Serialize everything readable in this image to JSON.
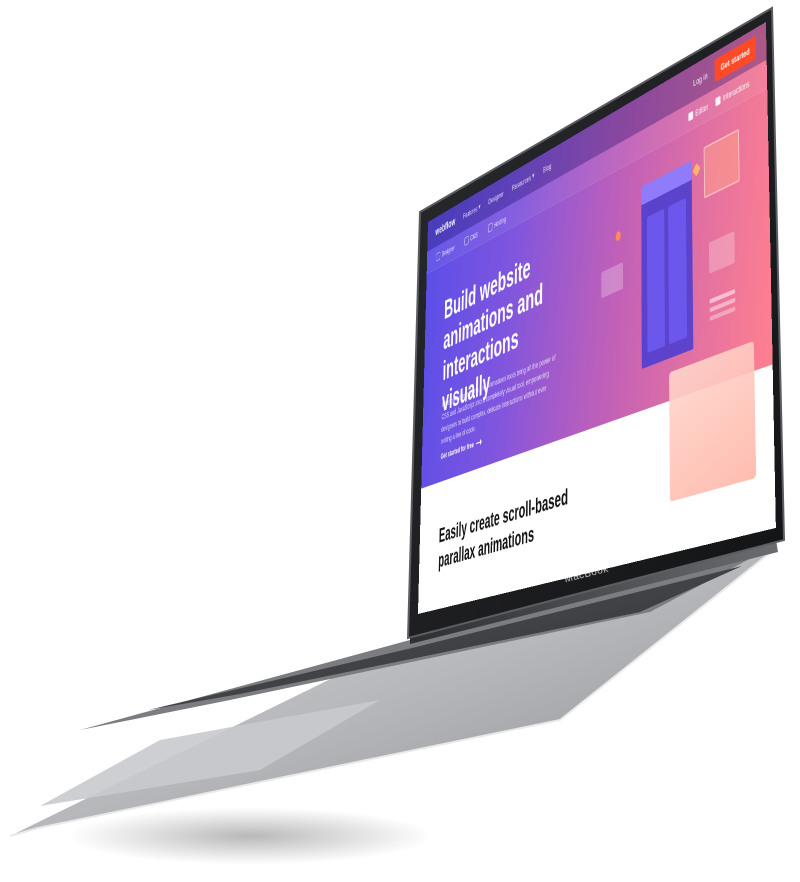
{
  "website": {
    "logo": "webflow",
    "nav": {
      "items": [
        "Features",
        "Designer",
        "Resources",
        "Blog"
      ],
      "login": "Log in",
      "cta": "Get started"
    },
    "subnav": {
      "items": [
        "Designer",
        "CMS",
        "Hosting"
      ],
      "cta_items": [
        "Editor",
        "Interactions"
      ]
    },
    "hero": {
      "title": "Build website animations and interactions visually",
      "subtitle": "Webflow's Interactions and Animations tools bring all the power of CSS and JavaScript into a completely visual tool, empowering designers to build complex, delicate interactions without ever writing a line of code.",
      "link": "Get started for free"
    },
    "section2": {
      "title": "Easily create scroll-based parallax animations"
    }
  },
  "device": {
    "brand_label": "MacBook"
  },
  "colors": {
    "gradient_start": "#5a4ee8",
    "gradient_end": "#ff7f8e",
    "cta": "#ff4a28",
    "bezel": "#0f1012",
    "body": "#9a9ca0"
  }
}
